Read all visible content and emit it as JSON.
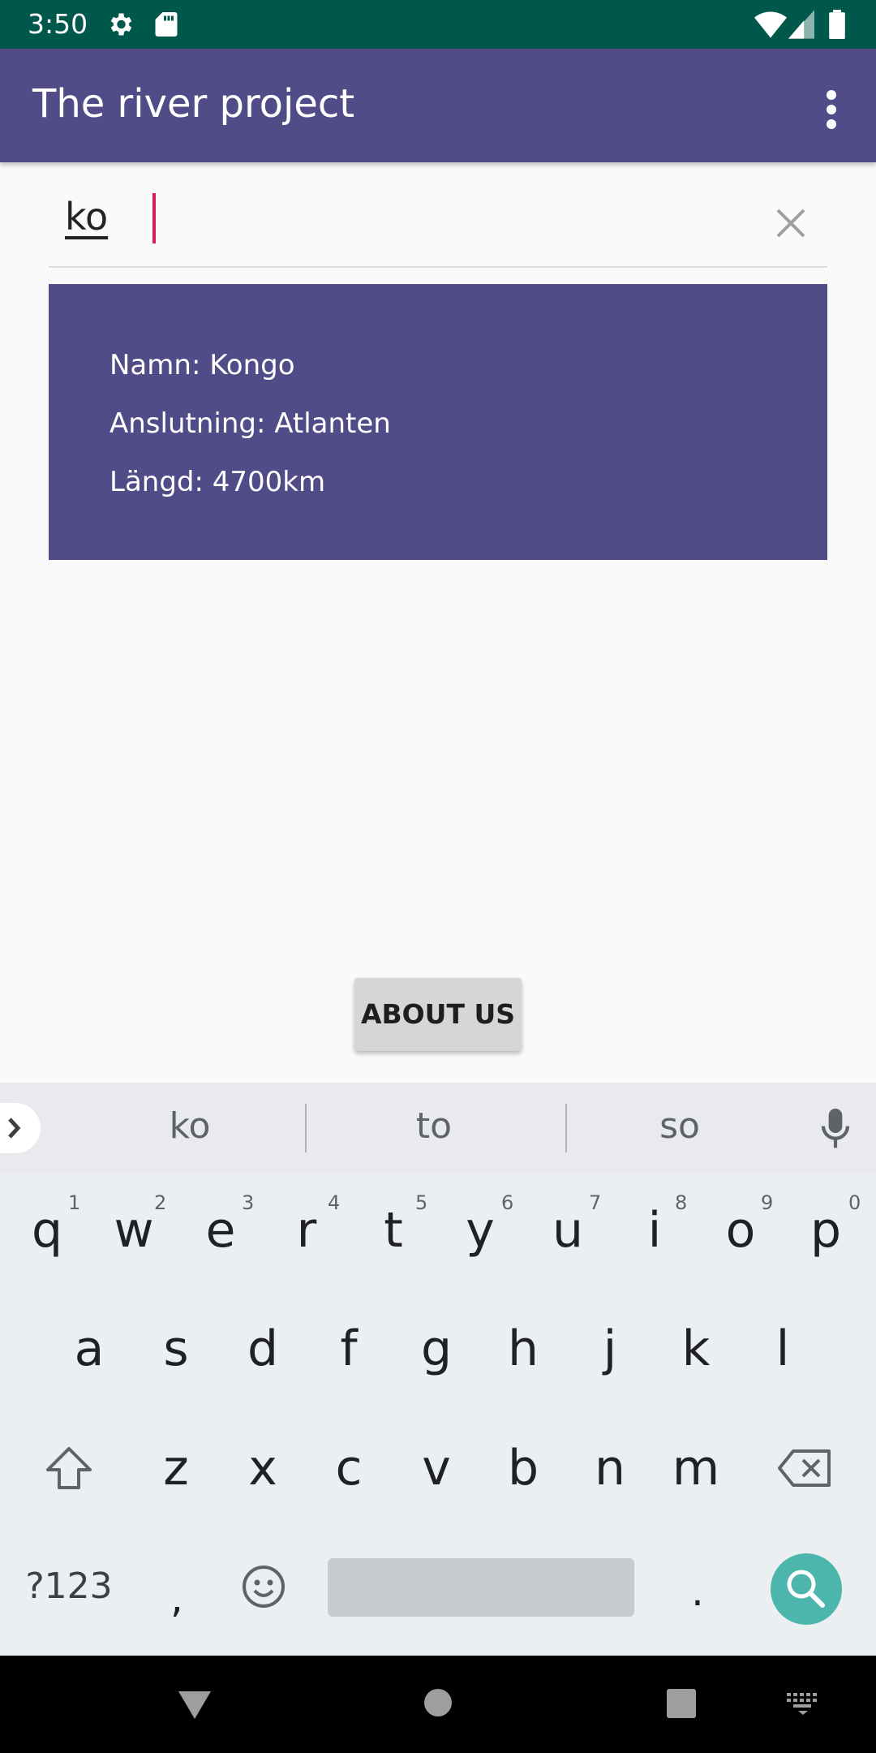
{
  "status_bar": {
    "time": "3:50",
    "icons": [
      "settings-icon",
      "sd-card-icon",
      "wifi-icon",
      "signal-icon",
      "battery-icon"
    ]
  },
  "app_bar": {
    "title": "The river project",
    "menu_icon": "more-vert-icon"
  },
  "search": {
    "value": "ko",
    "clear_icon": "close-icon"
  },
  "result": {
    "name": "Namn: Kongo",
    "connection": "Anslutning: Atlanten",
    "length": "Längd: 4700km"
  },
  "about_button": {
    "label": "ABOUT US"
  },
  "keyboard": {
    "suggestions": [
      "ko",
      "to",
      "so"
    ],
    "row1": [
      "q",
      "w",
      "e",
      "r",
      "t",
      "y",
      "u",
      "i",
      "o",
      "p"
    ],
    "row1_hints": [
      "1",
      "2",
      "3",
      "4",
      "5",
      "6",
      "7",
      "8",
      "9",
      "0"
    ],
    "row2": [
      "a",
      "s",
      "d",
      "f",
      "g",
      "h",
      "j",
      "k",
      "l"
    ],
    "row3": [
      "z",
      "x",
      "c",
      "v",
      "b",
      "n",
      "m"
    ],
    "symbols_label": "?123",
    "comma": ",",
    "period": "."
  },
  "colors": {
    "status_bar": "#00574b",
    "primary": "#514b88",
    "cursor": "#d81b60",
    "search_fab": "#4db6ac"
  }
}
